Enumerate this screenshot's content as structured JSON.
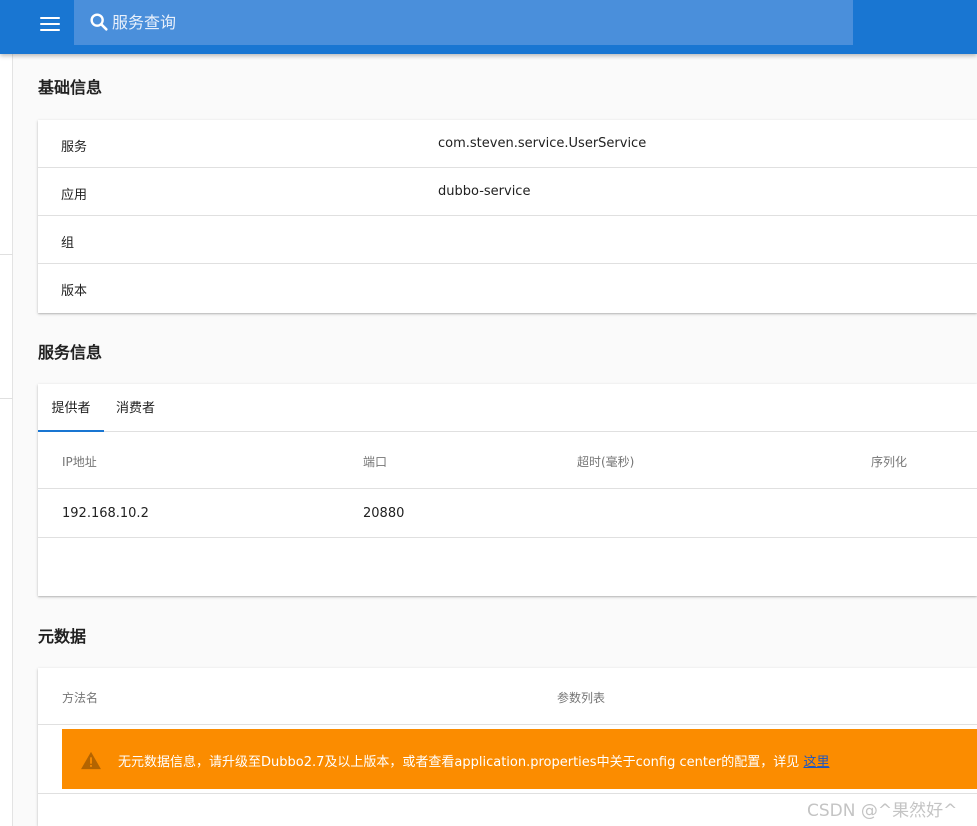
{
  "header": {
    "search_placeholder": "服务查询",
    "icons": {
      "menu": "hamburger-menu-icon",
      "search": "search-icon"
    },
    "colors": {
      "toolbar": "#1976d2",
      "search_bg": "#4a8fdb"
    }
  },
  "basic_info": {
    "title": "基础信息",
    "rows": [
      {
        "label": "服务",
        "value": "com.steven.service.UserService"
      },
      {
        "label": "应用",
        "value": "dubbo-service"
      },
      {
        "label": "组",
        "value": ""
      },
      {
        "label": "版本",
        "value": ""
      }
    ]
  },
  "service_info": {
    "title": "服务信息",
    "tabs": [
      {
        "label": "提供者",
        "active": true
      },
      {
        "label": "消费者",
        "active": false
      }
    ],
    "columns": [
      "IP地址",
      "端口",
      "超时(毫秒)",
      "序列化"
    ],
    "rows": [
      [
        "192.168.10.2",
        "20880",
        "",
        ""
      ]
    ]
  },
  "metadata": {
    "title": "元数据",
    "columns": [
      "方法名",
      "参数列表"
    ],
    "alert": {
      "text": "无元数据信息，请升级至Dubbo2.7及以上版本，或者查看application.properties中关于config center的配置，详见 ",
      "link": "这里",
      "color": "#fb8c00",
      "icon": "warning-icon"
    }
  },
  "watermark": "CSDN @^果然好^"
}
